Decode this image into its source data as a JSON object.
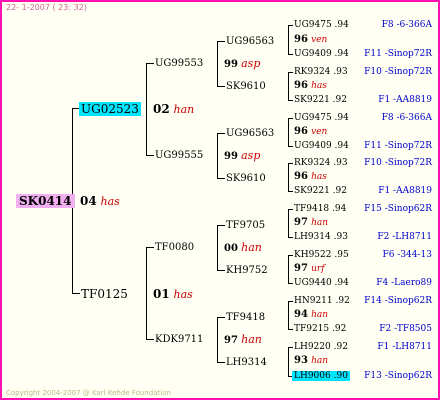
{
  "header": {
    "text": "22- 1-2007 ( 23: 32)"
  },
  "footer": {
    "text": "Copyright 2004-2007 @ Karl Kehde Foundation"
  },
  "root": {
    "ring": "SK0414",
    "year": "04",
    "label": "has"
  },
  "sire": {
    "ring": "UG02523",
    "year": "02",
    "label": "han"
  },
  "dam": {
    "ring": "TF0125",
    "year": "01",
    "label": "has"
  },
  "gen3": [
    {
      "ring": "UG99553",
      "year": "99",
      "label": "asp"
    },
    {
      "ring": "UG99555",
      "year": "99",
      "label": "asp"
    },
    {
      "ring": "TF0080",
      "year": "00",
      "label": "han"
    },
    {
      "ring": "KDK9711",
      "year": "97",
      "label": "han"
    }
  ],
  "gen4": [
    {
      "ring": "UG96563",
      "year": "96",
      "label": "ven"
    },
    {
      "ring": "SK9610",
      "year": "96",
      "label": "has"
    },
    {
      "ring": "UG96563",
      "year": "96",
      "label": "ven"
    },
    {
      "ring": "SK9610",
      "year": "96",
      "label": "has"
    },
    {
      "ring": "TF9705",
      "year": "97",
      "label": "han"
    },
    {
      "ring": "KH9752",
      "year": "97",
      "label": "urf"
    },
    {
      "ring": "TF9418",
      "year": "94",
      "label": "han"
    },
    {
      "ring": "LH9314",
      "year": "93",
      "label": "han"
    }
  ],
  "gen5": [
    {
      "ring": "UG9475",
      "year": "94",
      "ped": "F8 -6-366A"
    },
    {
      "ring": "UG9409",
      "year": "94",
      "ped": "F11 -Sinop72R"
    },
    {
      "ring": "RK9324",
      "year": "93",
      "ped": "F10 -Sinop72R"
    },
    {
      "ring": "SK9221",
      "year": "92",
      "ped": "F1 -AA8819"
    },
    {
      "ring": "UG9475",
      "year": "94",
      "ped": "F8 -6-366A"
    },
    {
      "ring": "UG9409",
      "year": "94",
      "ped": "F11 -Sinop72R"
    },
    {
      "ring": "RK9324",
      "year": "93",
      "ped": "F10 -Sinop72R"
    },
    {
      "ring": "SK9221",
      "year": "92",
      "ped": "F1 -AA8819"
    },
    {
      "ring": "TF9418",
      "year": "94",
      "ped": "F15 -Sinop62R"
    },
    {
      "ring": "LH9314",
      "year": "93",
      "ped": "F2 -LH8711"
    },
    {
      "ring": "KH9522",
      "year": "95",
      "ped": "F6 -344-13"
    },
    {
      "ring": "UG9440",
      "year": "94",
      "ped": "F4 -Laero89"
    },
    {
      "ring": "HN9211",
      "year": "92",
      "ped": "F14 -Sinop62R"
    },
    {
      "ring": "TF9215",
      "year": "92",
      "ped": "F2 -TF8505"
    },
    {
      "ring": "LH9220",
      "year": "92",
      "ped": "F1 -LH8711"
    },
    {
      "ring": "LH9006",
      "year": "90",
      "ped": "F13 -Sinop62R"
    }
  ]
}
